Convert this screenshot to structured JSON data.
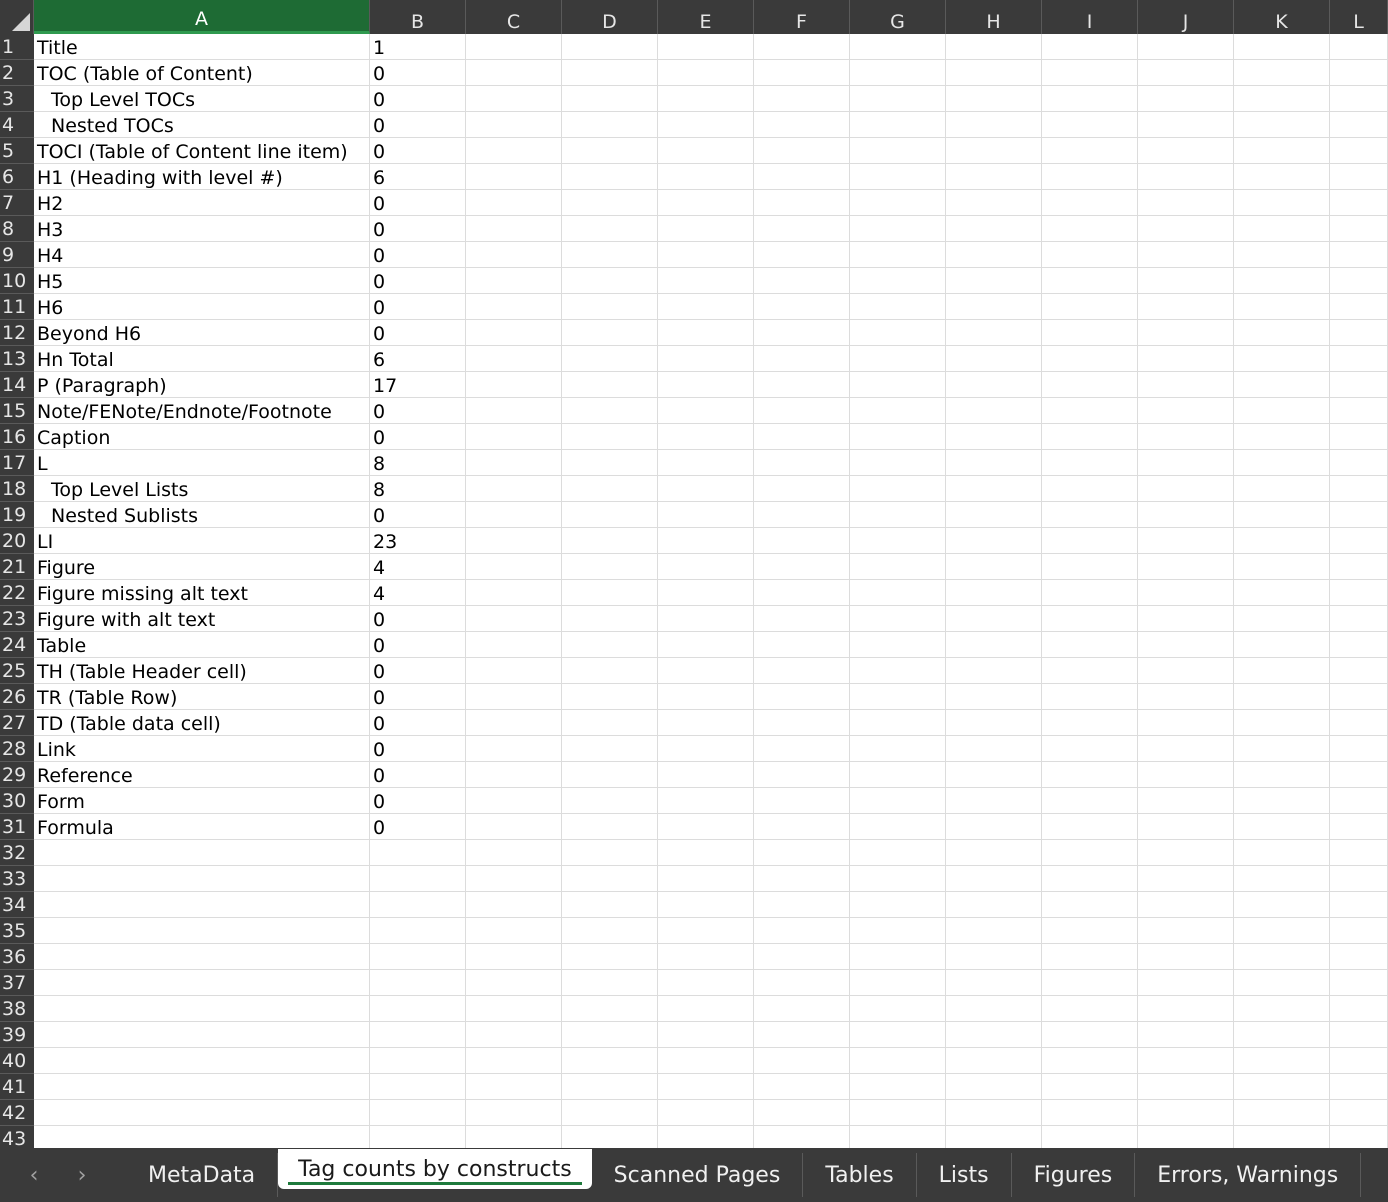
{
  "columns": [
    "A",
    "B",
    "C",
    "D",
    "E",
    "F",
    "G",
    "H",
    "I",
    "J",
    "K",
    "L"
  ],
  "selected_column": "A",
  "rows": [
    {
      "num": "1",
      "a": "Title",
      "b": "1"
    },
    {
      "num": "2",
      "a": "TOC (Table of Content)",
      "b": "0"
    },
    {
      "num": "3",
      "a": "Top Level TOCs",
      "b": "0",
      "indent": true
    },
    {
      "num": "4",
      "a": "Nested TOCs",
      "b": "0",
      "indent": true
    },
    {
      "num": "5",
      "a": "TOCI (Table of Content line item)",
      "b": "0"
    },
    {
      "num": "6",
      "a": "H1 (Heading with level #)",
      "b": "6"
    },
    {
      "num": "7",
      "a": "H2",
      "b": "0"
    },
    {
      "num": "8",
      "a": "H3",
      "b": "0"
    },
    {
      "num": "9",
      "a": "H4",
      "b": "0"
    },
    {
      "num": "10",
      "a": "H5",
      "b": "0"
    },
    {
      "num": "11",
      "a": "H6",
      "b": "0"
    },
    {
      "num": "12",
      "a": "Beyond H6",
      "b": "0"
    },
    {
      "num": "13",
      "a": "Hn Total",
      "b": "6"
    },
    {
      "num": "14",
      "a": "P (Paragraph)",
      "b": "17"
    },
    {
      "num": "15",
      "a": "Note/FENote/Endnote/Footnote",
      "b": "0"
    },
    {
      "num": "16",
      "a": "Caption",
      "b": "0"
    },
    {
      "num": "17",
      "a": "L",
      "b": "8"
    },
    {
      "num": "18",
      "a": "Top Level Lists",
      "b": "8",
      "indent": true
    },
    {
      "num": "19",
      "a": "Nested Sublists",
      "b": "0",
      "indent": true
    },
    {
      "num": "20",
      "a": "LI",
      "b": "23"
    },
    {
      "num": "21",
      "a": "Figure",
      "b": "4"
    },
    {
      "num": "22",
      "a": "Figure missing alt text",
      "b": "4"
    },
    {
      "num": "23",
      "a": "Figure with alt text",
      "b": "0"
    },
    {
      "num": "24",
      "a": "Table",
      "b": "0"
    },
    {
      "num": "25",
      "a": "TH (Table Header cell)",
      "b": "0"
    },
    {
      "num": "26",
      "a": "TR (Table Row)",
      "b": "0"
    },
    {
      "num": "27",
      "a": "TD (Table data cell)",
      "b": "0"
    },
    {
      "num": "28",
      "a": "Link",
      "b": "0"
    },
    {
      "num": "29",
      "a": "Reference",
      "b": "0"
    },
    {
      "num": "30",
      "a": "Form",
      "b": "0"
    },
    {
      "num": "31",
      "a": "Formula",
      "b": "0"
    },
    {
      "num": "32",
      "a": "",
      "b": ""
    },
    {
      "num": "33",
      "a": "",
      "b": ""
    },
    {
      "num": "34",
      "a": "",
      "b": ""
    },
    {
      "num": "35",
      "a": "",
      "b": ""
    },
    {
      "num": "36",
      "a": "",
      "b": ""
    },
    {
      "num": "37",
      "a": "",
      "b": ""
    },
    {
      "num": "38",
      "a": "",
      "b": ""
    },
    {
      "num": "39",
      "a": "",
      "b": ""
    },
    {
      "num": "40",
      "a": "",
      "b": ""
    },
    {
      "num": "41",
      "a": "",
      "b": ""
    },
    {
      "num": "42",
      "a": "",
      "b": ""
    },
    {
      "num": "43",
      "a": "",
      "b": ""
    }
  ],
  "tabs": {
    "nav_prev": "‹",
    "nav_next": "›",
    "sheets": [
      {
        "label": "MetaData",
        "active": false
      },
      {
        "label": "Tag counts by constructs",
        "active": true
      },
      {
        "label": "Scanned Pages",
        "active": false
      },
      {
        "label": "Tables",
        "active": false
      },
      {
        "label": "Lists",
        "active": false
      },
      {
        "label": "Figures",
        "active": false
      },
      {
        "label": "Errors, Warnings",
        "active": false
      }
    ]
  },
  "colors": {
    "header_bg": "#3a3a3a",
    "selected_header": "#1e6b34",
    "active_tab_underline": "#1e7a3c",
    "gridline": "#dcdcdc"
  }
}
